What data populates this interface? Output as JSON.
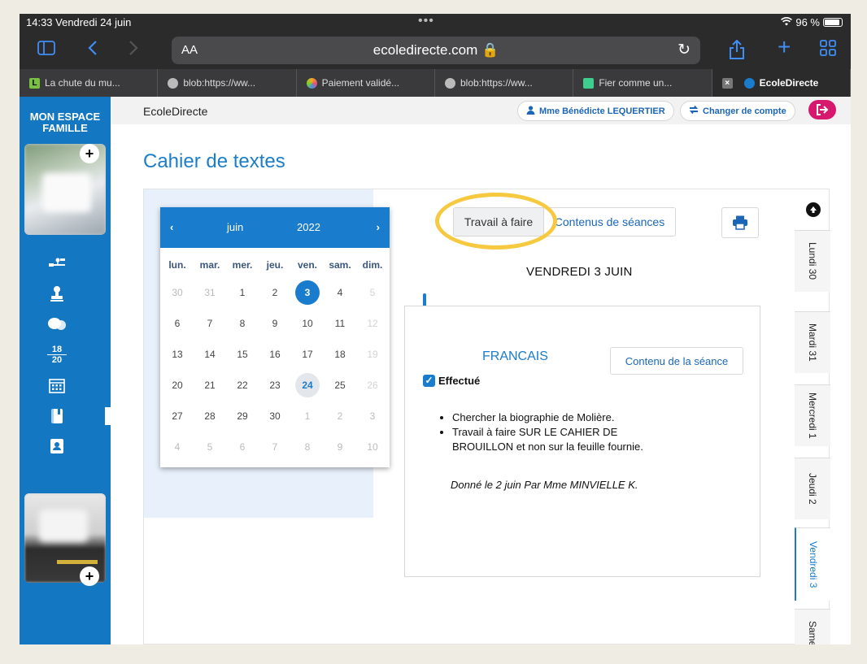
{
  "status_bar": {
    "time_date": "14:33  Vendredi 24 juin",
    "dots": "•••",
    "battery": "96 %"
  },
  "browser": {
    "text_size": "AA",
    "url": "ecoledirecte.com 🔒",
    "tabs": [
      {
        "label": "La chute du mu...",
        "icon_color": "#7ac142",
        "icon_letter": "L"
      },
      {
        "label": "blob:https://ww...",
        "icon_color": "#bbbbbb",
        "icon_letter": ""
      },
      {
        "label": "Paiement validé...",
        "icon_color": "#f5a623",
        "icon_letter": ""
      },
      {
        "label": "blob:https://ww...",
        "icon_color": "#bbbbbb",
        "icon_letter": ""
      },
      {
        "label": "Fier comme un...",
        "icon_color": "#3ecf8e",
        "icon_letter": ""
      },
      {
        "label": "EcoleDirecte",
        "icon_color": "#1a7ccc",
        "icon_letter": ""
      }
    ]
  },
  "sidebar": {
    "title_line1": "MON ESPACE",
    "title_line2": "FAMILLE",
    "grades_label_top": "18",
    "grades_label_bottom": "20"
  },
  "header": {
    "site_name": "EcoleDirecte",
    "user_name": "Mme Bénédicte LEQUERTIER",
    "switch_account": "Changer de compte"
  },
  "page_title": "Cahier de textes",
  "calendar": {
    "prev": "‹",
    "next": "›",
    "month": "juin",
    "year": "2022",
    "weekdays": [
      "lun.",
      "mar.",
      "mer.",
      "jeu.",
      "ven.",
      "sam.",
      "dim."
    ],
    "weeks": [
      [
        "30",
        "31",
        "1",
        "2",
        "3",
        "4",
        "5"
      ],
      [
        "6",
        "7",
        "8",
        "9",
        "10",
        "11",
        "12"
      ],
      [
        "13",
        "14",
        "15",
        "16",
        "17",
        "18",
        "19"
      ],
      [
        "20",
        "21",
        "22",
        "23",
        "24",
        "25",
        "26"
      ],
      [
        "27",
        "28",
        "29",
        "30",
        "1",
        "2",
        "3"
      ],
      [
        "4",
        "5",
        "6",
        "7",
        "8",
        "9",
        "10"
      ]
    ],
    "selected_day": "3",
    "today_day": "24"
  },
  "panel": {
    "tab_travail": "Travail à faire",
    "tab_contenus": "Contenus de séances",
    "day_title": "VENDREDI 3 JUIN",
    "subject": "FRANCAIS",
    "seance_button": "Contenu de la séance",
    "done_label": "Effectué",
    "tasks": [
      "Chercher la biographie de Molière.",
      "Travail à faire SUR LE CAHIER DE BROUILLON et non sur la feuille fournie."
    ],
    "given_by": "Donné le 2 juin Par Mme MINVIELLE K."
  },
  "day_tabs": [
    "Lundi 30",
    "Mardi 31",
    "Mercredi 1",
    "Jeudi 2",
    "Vendredi 3",
    "Same"
  ],
  "colors": {
    "brand_blue": "#1a7ccc",
    "highlight": "#f7c940",
    "logout": "#d6186f"
  }
}
